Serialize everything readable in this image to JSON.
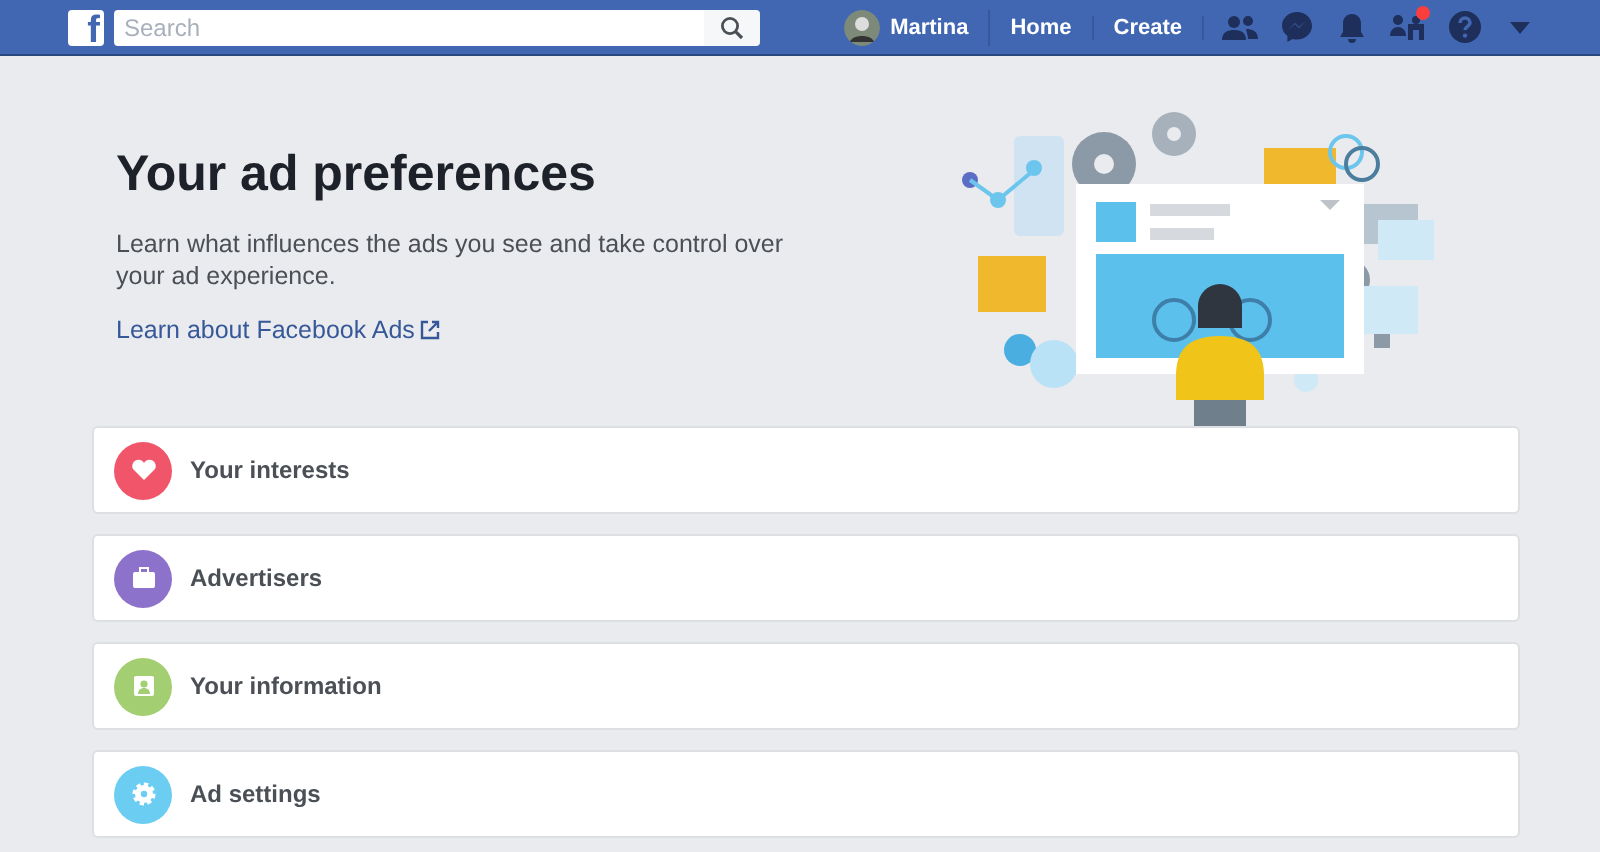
{
  "topbar": {
    "logo": "f",
    "search": {
      "placeholder": "Search"
    },
    "user": "Martina",
    "links": [
      "Home",
      "Create"
    ],
    "icons": [
      {
        "kind": "friends",
        "alert": false
      },
      {
        "kind": "messenger",
        "alert": false
      },
      {
        "kind": "bell",
        "alert": false
      },
      {
        "kind": "groups",
        "alert": true
      },
      {
        "kind": "help",
        "alert": false
      },
      {
        "kind": "caret",
        "alert": false
      }
    ]
  },
  "header": {
    "title": "Your ad preferences",
    "description": "Learn what influences the ads you see and take control over your ad experience.",
    "link": "Learn about Facebook Ads"
  },
  "sections": [
    {
      "label": "Your interests",
      "kind": "heart",
      "color": "#f0556a"
    },
    {
      "label": "Advertisers",
      "kind": "briefcase",
      "color": "#8c72cb"
    },
    {
      "label": "Your information",
      "kind": "person",
      "color": "#a3ce71"
    },
    {
      "label": "Ad settings",
      "kind": "gear",
      "color": "#6bcdf2"
    }
  ]
}
